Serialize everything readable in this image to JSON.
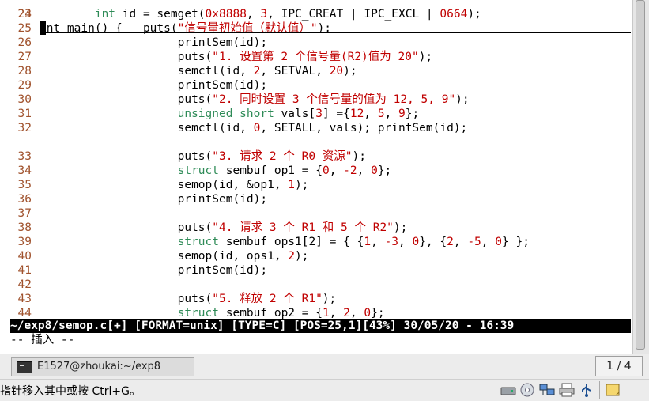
{
  "editor": {
    "top_partial": "int main() {",
    "lines": [
      {
        "num": "24",
        "parts": [
          [
            "i",
            "        "
          ],
          [
            "k",
            "int"
          ],
          [
            "p",
            " id = semget("
          ],
          [
            "n",
            "0x8888"
          ],
          [
            "p",
            ", "
          ],
          [
            "n",
            "3"
          ],
          [
            "p",
            ", IPC_CREAT | IPC_EXCL | "
          ],
          [
            "n",
            "0664"
          ],
          [
            "p",
            ");"
          ]
        ]
      },
      {
        "num": "25",
        "parts": [
          [
            "i",
            "               "
          ],
          [
            "p",
            "puts("
          ],
          [
            "s",
            "\"信号量初始值（默认值）\""
          ],
          [
            "p",
            ");"
          ]
        ]
      },
      {
        "num": "26",
        "parts": [
          [
            "i",
            "                    "
          ],
          [
            "p",
            "printSem(id);"
          ]
        ]
      },
      {
        "num": "27",
        "parts": [
          [
            "i",
            "                    "
          ],
          [
            "p",
            "puts("
          ],
          [
            "s",
            "\"1. 设置第 2 个信号量(R2)值为 20\""
          ],
          [
            "p",
            ");"
          ]
        ]
      },
      {
        "num": "28",
        "parts": [
          [
            "i",
            "                    "
          ],
          [
            "p",
            "semctl(id, "
          ],
          [
            "n",
            "2"
          ],
          [
            "p",
            ", SETVAL, "
          ],
          [
            "n",
            "20"
          ],
          [
            "p",
            ");"
          ]
        ]
      },
      {
        "num": "29",
        "parts": [
          [
            "i",
            "                    "
          ],
          [
            "p",
            "printSem(id);"
          ]
        ]
      },
      {
        "num": "30",
        "parts": [
          [
            "i",
            "                    "
          ],
          [
            "p",
            "puts("
          ],
          [
            "s",
            "\"2. 同时设置 3 个信号量的值为 12, 5, 9\""
          ],
          [
            "p",
            ");"
          ]
        ]
      },
      {
        "num": "31",
        "parts": [
          [
            "i",
            "                    "
          ],
          [
            "k",
            "unsigned short"
          ],
          [
            "p",
            " vals["
          ],
          [
            "n",
            "3"
          ],
          [
            "p",
            "] ={"
          ],
          [
            "n",
            "12"
          ],
          [
            "p",
            ", "
          ],
          [
            "n",
            "5"
          ],
          [
            "p",
            ", "
          ],
          [
            "n",
            "9"
          ],
          [
            "p",
            "};"
          ]
        ]
      },
      {
        "num": "32",
        "parts": [
          [
            "i",
            "                    "
          ],
          [
            "p",
            "semctl(id, "
          ],
          [
            "n",
            "0"
          ],
          [
            "p",
            ", SETALL, vals); printSem(id);"
          ]
        ]
      },
      {
        "num": "33",
        "parts": [
          [
            "i",
            "                    "
          ],
          [
            "p",
            "puts("
          ],
          [
            "s",
            "\"3. 请求 2 个 R0 资源\""
          ],
          [
            "p",
            ");"
          ]
        ]
      },
      {
        "num": "34",
        "parts": [
          [
            "i",
            "                    "
          ],
          [
            "k",
            "struct"
          ],
          [
            "p",
            " sembuf op1 = {"
          ],
          [
            "n",
            "0"
          ],
          [
            "p",
            ", "
          ],
          [
            "n",
            "-2"
          ],
          [
            "p",
            ", "
          ],
          [
            "n",
            "0"
          ],
          [
            "p",
            "};"
          ]
        ]
      },
      {
        "num": "35",
        "parts": [
          [
            "i",
            "                    "
          ],
          [
            "p",
            "semop(id, &op1, "
          ],
          [
            "n",
            "1"
          ],
          [
            "p",
            ");"
          ]
        ]
      },
      {
        "num": "36",
        "parts": [
          [
            "i",
            "                    "
          ],
          [
            "p",
            "printSem(id);"
          ]
        ]
      },
      {
        "num": "37",
        "parts": [
          [
            "i",
            ""
          ]
        ]
      },
      {
        "num": "38",
        "parts": [
          [
            "i",
            "                    "
          ],
          [
            "p",
            "puts("
          ],
          [
            "s",
            "\"4. 请求 3 个 R1 和 5 个 R2\""
          ],
          [
            "p",
            ");"
          ]
        ]
      },
      {
        "num": "39",
        "parts": [
          [
            "i",
            "                    "
          ],
          [
            "k",
            "struct"
          ],
          [
            "p",
            " sembuf ops1[2] = { {"
          ],
          [
            "n",
            "1"
          ],
          [
            "p",
            ", "
          ],
          [
            "n",
            "-3"
          ],
          [
            "p",
            ", "
          ],
          [
            "n",
            "0"
          ],
          [
            "p",
            "}, {"
          ],
          [
            "n",
            "2"
          ],
          [
            "p",
            ", "
          ],
          [
            "n",
            "-5"
          ],
          [
            "p",
            ", "
          ],
          [
            "n",
            "0"
          ],
          [
            "p",
            "} };"
          ]
        ]
      },
      {
        "num": "40",
        "parts": [
          [
            "i",
            "                    "
          ],
          [
            "p",
            "semop(id, ops1, "
          ],
          [
            "n",
            "2"
          ],
          [
            "p",
            ");"
          ]
        ]
      },
      {
        "num": "41",
        "parts": [
          [
            "i",
            "                    "
          ],
          [
            "p",
            "printSem(id);"
          ]
        ]
      },
      {
        "num": "42",
        "parts": [
          [
            "i",
            ""
          ]
        ]
      },
      {
        "num": "43",
        "parts": [
          [
            "i",
            "                    "
          ],
          [
            "p",
            "puts("
          ],
          [
            "s",
            "\"5. 释放 2 个 R1\""
          ],
          [
            "p",
            ");"
          ]
        ]
      },
      {
        "num": "44",
        "parts": [
          [
            "i",
            "                    "
          ],
          [
            "k",
            "struct"
          ],
          [
            "p",
            " sembuf op2 = {"
          ],
          [
            "n",
            "1"
          ],
          [
            "p",
            ", "
          ],
          [
            "n",
            "2"
          ],
          [
            "p",
            ", "
          ],
          [
            "n",
            "0"
          ],
          [
            "p",
            "};"
          ]
        ]
      }
    ]
  },
  "statusbar": {
    "text": "~/exp8/semop.c[+] [FORMAT=unix] [TYPE=C] [POS=25,1][43%] 30/05/20 - 16:39"
  },
  "modeline": {
    "text": "-- 插入 --"
  },
  "taskbar": {
    "window_label": "E1527@zhoukai:~/exp8",
    "pager": "1 / 4"
  },
  "status_message": "指针移入其中或按 Ctrl+G。",
  "tray_icons": [
    "hard-disk-icon",
    "cd-drive-icon",
    "network-icon",
    "printer-icon",
    "usb-icon",
    "notes-icon"
  ]
}
